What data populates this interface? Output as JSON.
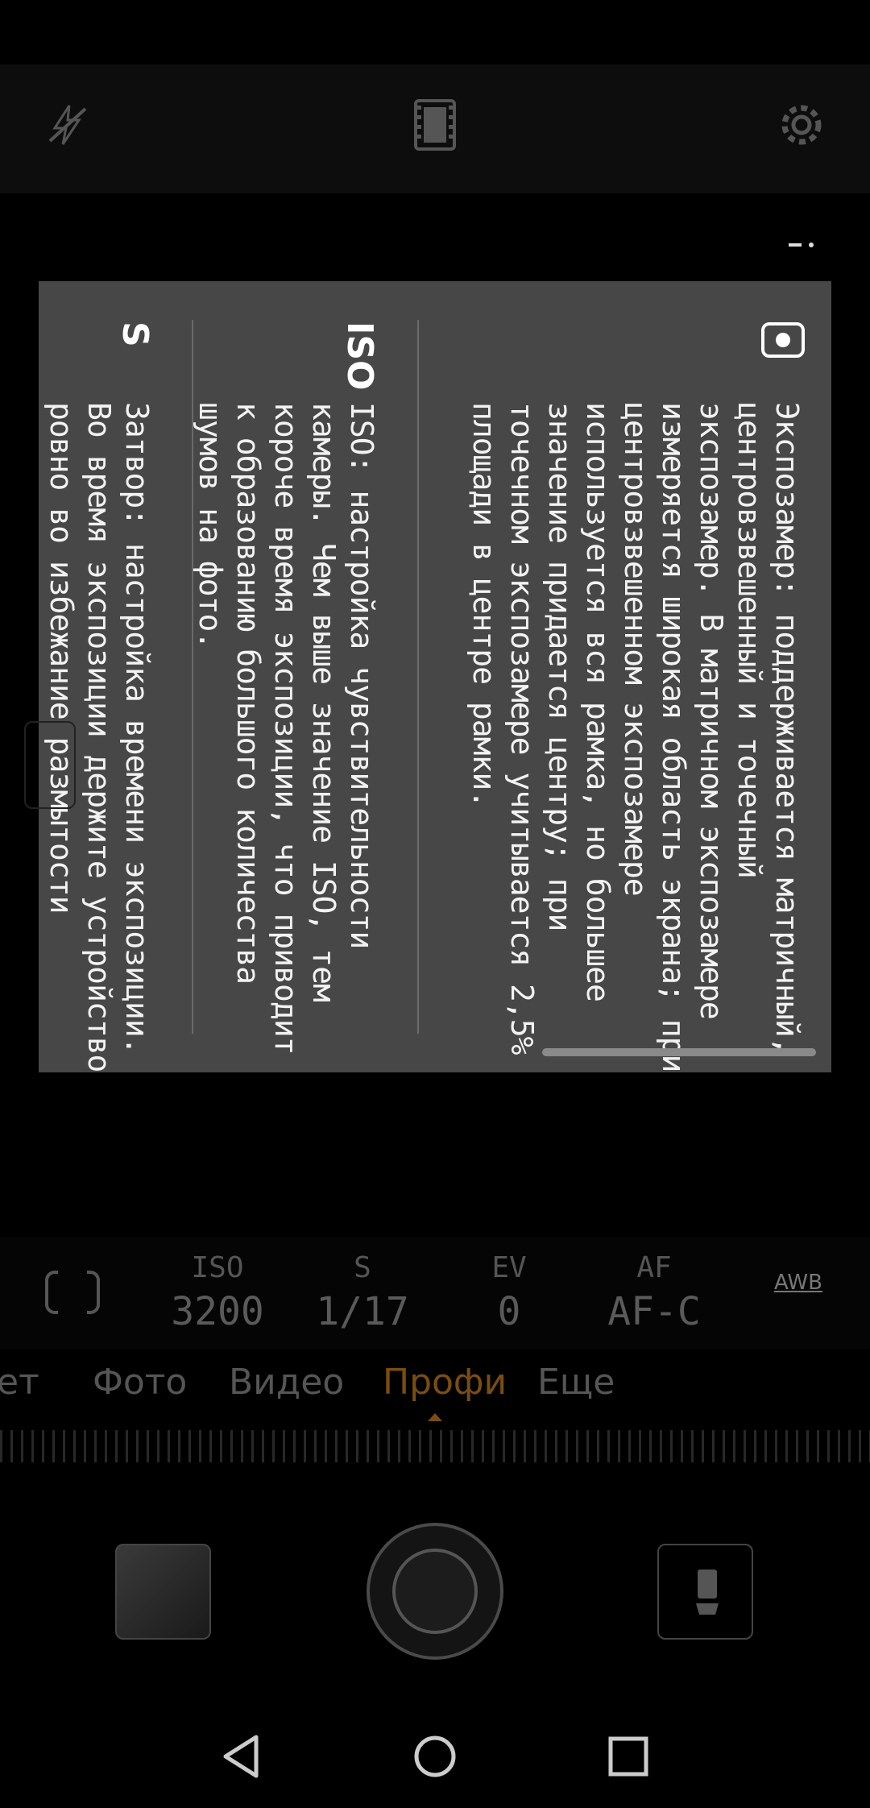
{
  "help": {
    "sections": [
      {
        "icon": "metering-spot-icon",
        "text": "Экспозамер: поддерживается матричный, центровзвешенный и точечный экспозамер. В матричном экспозамере измеряется широкая область экрана; при центровзвешенном экспозамере используется вся рамка, но большее значение придается центру; при точечном экспозамере учитывается 2,5% площади в центре рамки."
      },
      {
        "title": "ISO",
        "text": "ISO: настройка чувствительности камеры. Чем выше значение ISO, тем короче время экспозиции, что приводит к образованию большого количества шумов на фото."
      },
      {
        "title": "S",
        "text": "Затвор: настройка времени экспозиции. Во время экспозиции держите устройство ровно во избежание размытости"
      }
    ]
  },
  "params": [
    {
      "label": "ISO",
      "value": "3200"
    },
    {
      "label": "S",
      "value": "1/17"
    },
    {
      "label": "EV",
      "value": "0"
    },
    {
      "label": "AF",
      "value": "AF-C"
    }
  ],
  "awb": "AWB",
  "modes": [
    {
      "label": "ет",
      "active": false
    },
    {
      "label": "Фото",
      "active": false
    },
    {
      "label": "Видео",
      "active": false
    },
    {
      "label": "Профи",
      "active": true
    },
    {
      "label": "Еще",
      "active": false
    }
  ],
  "colors": {
    "accent": "#7a4d10",
    "panel": "#474747"
  }
}
